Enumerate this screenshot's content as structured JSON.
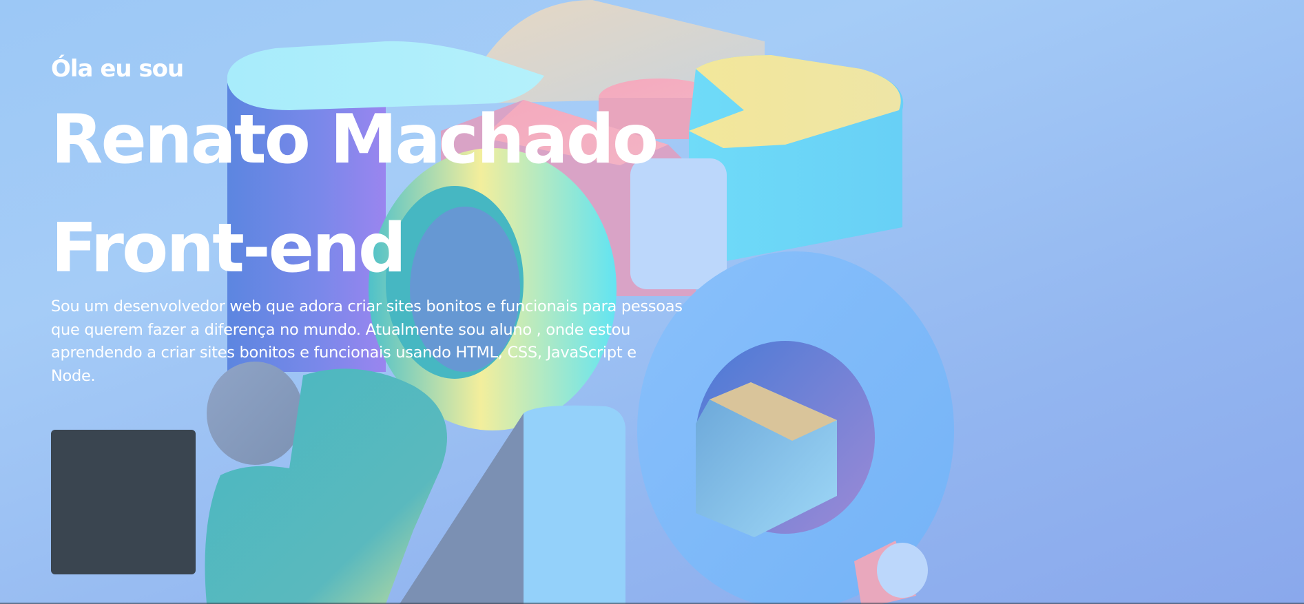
{
  "hero": {
    "greeting": "Óla eu sou",
    "name": "Renato Machado",
    "role": "Front-end",
    "bio": "Sou um desenvolvedor web que adora criar sites bonitos e funcionais para pessoas que querem fazer a diferença no mundo. Atualmente sou aluno , onde estou aprendendo a criar sites bonitos e funcionais usando HTML, CSS, JavaScript e Node.",
    "cta_label": ""
  },
  "colors": {
    "background": "#a5ccf7",
    "text": "#ffffff",
    "cta": "#3a4550"
  }
}
